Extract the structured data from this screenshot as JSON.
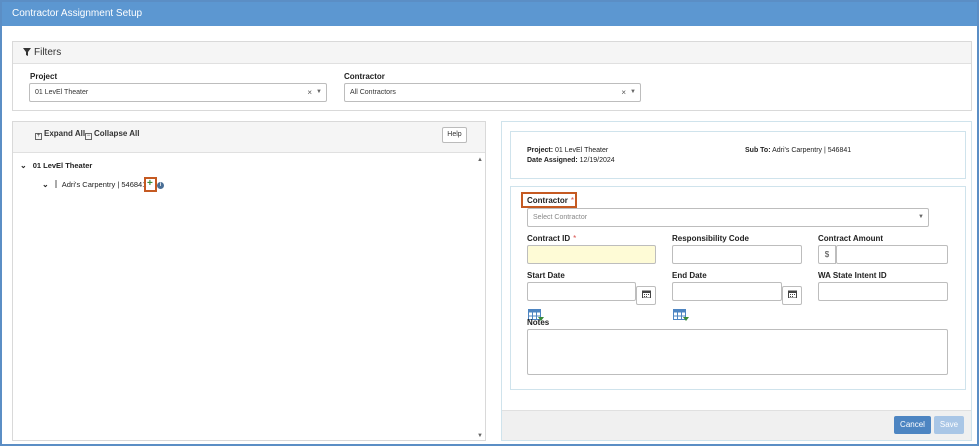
{
  "window": {
    "title": "Contractor Assignment Setup"
  },
  "filters": {
    "header": "Filters",
    "project_label": "Project",
    "project_value": "01 LevEl Theater",
    "contractor_label": "Contractor",
    "contractor_value": "All Contractors"
  },
  "tree": {
    "expand_all": "Expand All",
    "collapse_all": "Collapse All",
    "help": "Help",
    "root": "01 LevEl Theater",
    "child": "Adri's Carpentry | 546841"
  },
  "details": {
    "project_label": "Project:",
    "project_value": "01 LevEl Theater",
    "date_label": "Date Assigned:",
    "date_value": "12/19/2024",
    "sub_label": "Sub To:",
    "sub_value": "Adri's Carpentry | 546841"
  },
  "form": {
    "contractor_label": "Contractor",
    "contractor_placeholder": "Select Contractor",
    "contract_id_label": "Contract ID",
    "responsibility_code_label": "Responsibility Code",
    "contract_amount_label": "Contract Amount",
    "currency_symbol": "$",
    "start_date_label": "Start Date",
    "end_date_label": "End Date",
    "wa_state_label": "WA State Intent ID",
    "notes_label": "Notes",
    "required_mark": "*"
  },
  "footer": {
    "cancel": "Cancel",
    "save": "Save"
  },
  "icons": {
    "filter": "filter-icon",
    "calendar": "calendar-icon",
    "add": "plus-icon",
    "info": "info-icon",
    "grid": "spreadsheet-icon"
  },
  "colors": {
    "titlebar": "#5c97d1",
    "highlight": "#c55a22",
    "cancel": "#4d85c2",
    "save_disabled": "#a9c6e6",
    "required": "#d9534f"
  }
}
